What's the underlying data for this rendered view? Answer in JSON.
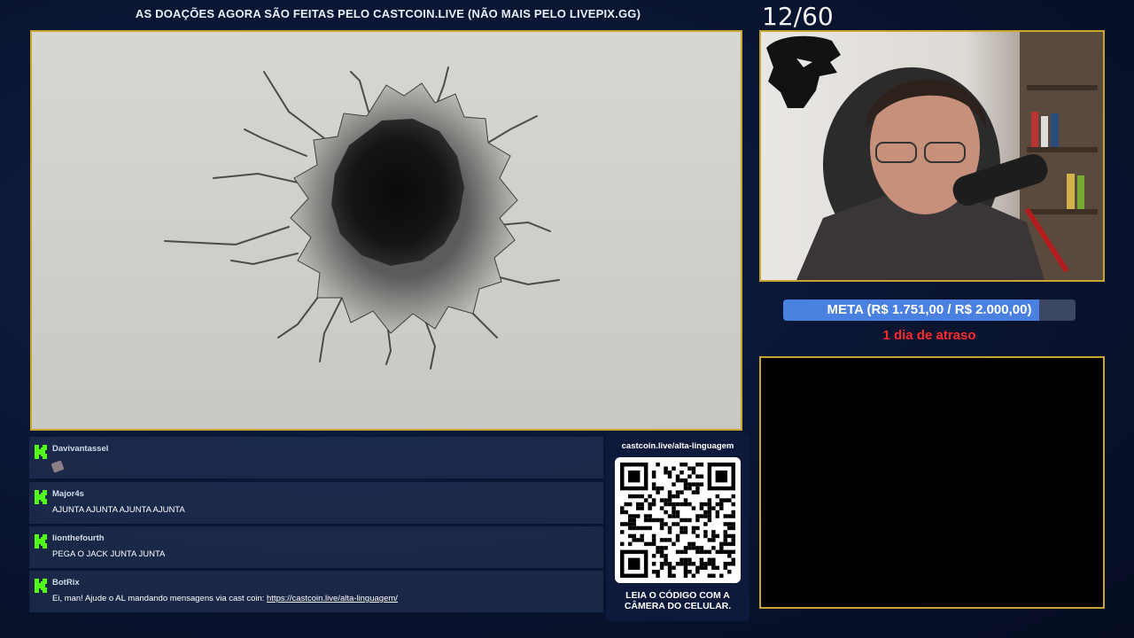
{
  "banner": "AS DOAÇÕES AGORA SÃO FEITAS PELO CASTCOIN.LIVE (NÃO MAIS PELO LIVEPIX.GG)",
  "counter": "12/60",
  "goal": {
    "label": "META (R$ 1.751,00 / R$ 2.000,00)",
    "current": 1751,
    "target": 2000,
    "fraction": 0.8755,
    "fill_color": "#4a80df"
  },
  "delay_text": "1 dia de atraso",
  "chat": {
    "messages": [
      {
        "user": "Davivantassel",
        "text": "",
        "emote": "pickaxe-emote"
      },
      {
        "user": "Major4s",
        "text": "AJUNTA AJUNTA AJUNTA AJUNTA"
      },
      {
        "user": "lionthefourth",
        "text": "PEGA O JACK JUNTA JUNTA"
      },
      {
        "user": "BotRix",
        "text": "Ei, man! Ajude o AL mandando mensagens via cast coin: ",
        "link": "https://castcoin.live/alta-linguagem/"
      }
    ],
    "platform_icon": "kick-icon",
    "platform_color": "#53fc18"
  },
  "qr": {
    "url": "castcoin.live/alta-linguagem",
    "caption_line1": "LEIA O CÓDIGO COM A",
    "caption_line2": "CÂMERA DO CELULAR."
  },
  "colors": {
    "frame_border": "#c9a431",
    "background": "#0a1634",
    "delay_red": "#ff2b2b"
  },
  "logo": "panther-logo-icon"
}
